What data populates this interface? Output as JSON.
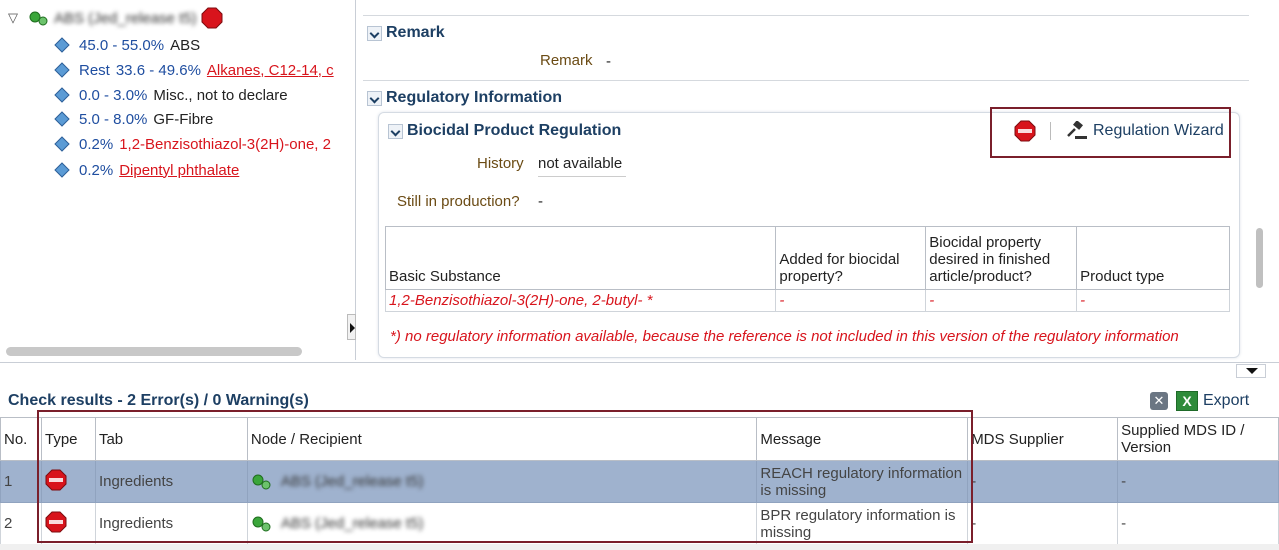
{
  "tree": {
    "root_label": "ABS (Jed_release t5)",
    "items": [
      {
        "range": "45.0 - 55.0%",
        "prefix": "",
        "name": "ABS",
        "style": "plain"
      },
      {
        "range": "33.6 - 49.6%",
        "prefix": "Rest",
        "name": "Alkanes, C12-14, c",
        "style": "red-link"
      },
      {
        "range": "0.0 - 3.0%",
        "prefix": "",
        "name": "Misc., not to declare",
        "style": "plain"
      },
      {
        "range": "5.0 - 8.0%",
        "prefix": "",
        "name": "GF-Fibre",
        "style": "plain"
      },
      {
        "range": "0.2%",
        "prefix": "",
        "name": "1,2-Benzisothiazol-3(2H)-one, 2",
        "style": "red-text"
      },
      {
        "range": "0.2%",
        "prefix": "",
        "name": "Dipentyl phthalate",
        "style": "red-link"
      }
    ]
  },
  "remark": {
    "section_title": "Remark",
    "label": "Remark",
    "value": "-"
  },
  "regulatory": {
    "section_title": "Regulatory Information",
    "bpr_title": "Biocidal Product Regulation",
    "wizard_label": "Regulation Wizard",
    "history_label": "History",
    "history_value": "not available",
    "production_label": "Still in production?",
    "production_value": "-",
    "table": {
      "headers": [
        "Basic Substance",
        "Added for biocidal property?",
        "Biocidal property desired in finished article/product?",
        "Product type"
      ],
      "rows": [
        [
          "1,2-Benzisothiazol-3(2H)-one, 2-butyl- *",
          "-",
          "-",
          "-"
        ]
      ]
    },
    "footnote": "*) no regulatory information available, because the reference is not included in this version of the regulatory information"
  },
  "check_results": {
    "title": "Check results - 2 Error(s) / 0 Warning(s)",
    "export_label": "Export",
    "headers": [
      "No.",
      "Type",
      "Tab",
      "Node / Recipient",
      "Message",
      "MDS Supplier",
      "Supplied MDS ID / Version"
    ],
    "rows": [
      {
        "no": "1",
        "tab": "Ingredients",
        "node": "ABS (Jed_release t5)",
        "message": "REACH regulatory information is missing",
        "supplier": "-",
        "supplied_id": "-"
      },
      {
        "no": "2",
        "tab": "Ingredients",
        "node": "ABS (Jed_release t5)",
        "message": "BPR regulatory information is missing",
        "supplier": "-",
        "supplied_id": "-"
      }
    ]
  },
  "icons": {
    "stop": "stop-icon",
    "diamond": "substance-diamond-icon",
    "node": "green-node-icon",
    "gavel": "gavel-icon",
    "excel": "excel-icon"
  },
  "colors": {
    "header_blue": "#1d3f63",
    "error_red": "#d8141c",
    "selected_row": "#9fb2ce",
    "highlight_box": "#7a1f2b"
  }
}
